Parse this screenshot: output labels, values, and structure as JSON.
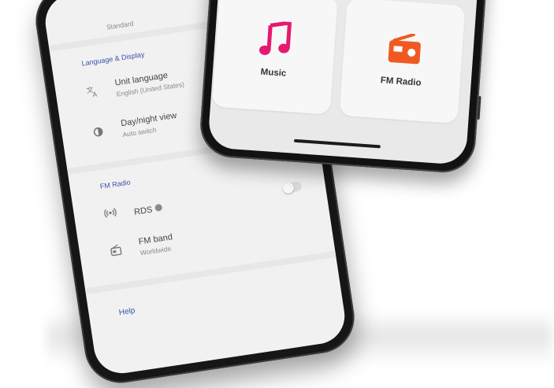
{
  "back_phone": {
    "top_item_subtitle": "Standard",
    "section_language": "Language & Display",
    "unit_language": {
      "title": "Unit language",
      "subtitle": "English (United States)"
    },
    "day_night": {
      "title": "Day/night view",
      "subtitle": "Auto switch"
    },
    "section_fm": "FM Radio",
    "rds": {
      "title": "RDS"
    },
    "fm_band": {
      "title": "FM band",
      "subtitle": "Worldwide"
    },
    "section_help": "Help"
  },
  "front_phone": {
    "tiles": [
      {
        "label": "Music",
        "icon": "music-note-icon",
        "color": "#e6196e"
      },
      {
        "label": "FM Radio",
        "icon": "radio-icon",
        "color": "#f05a22"
      }
    ]
  },
  "colors": {
    "accent_section": "#3a50b0"
  }
}
